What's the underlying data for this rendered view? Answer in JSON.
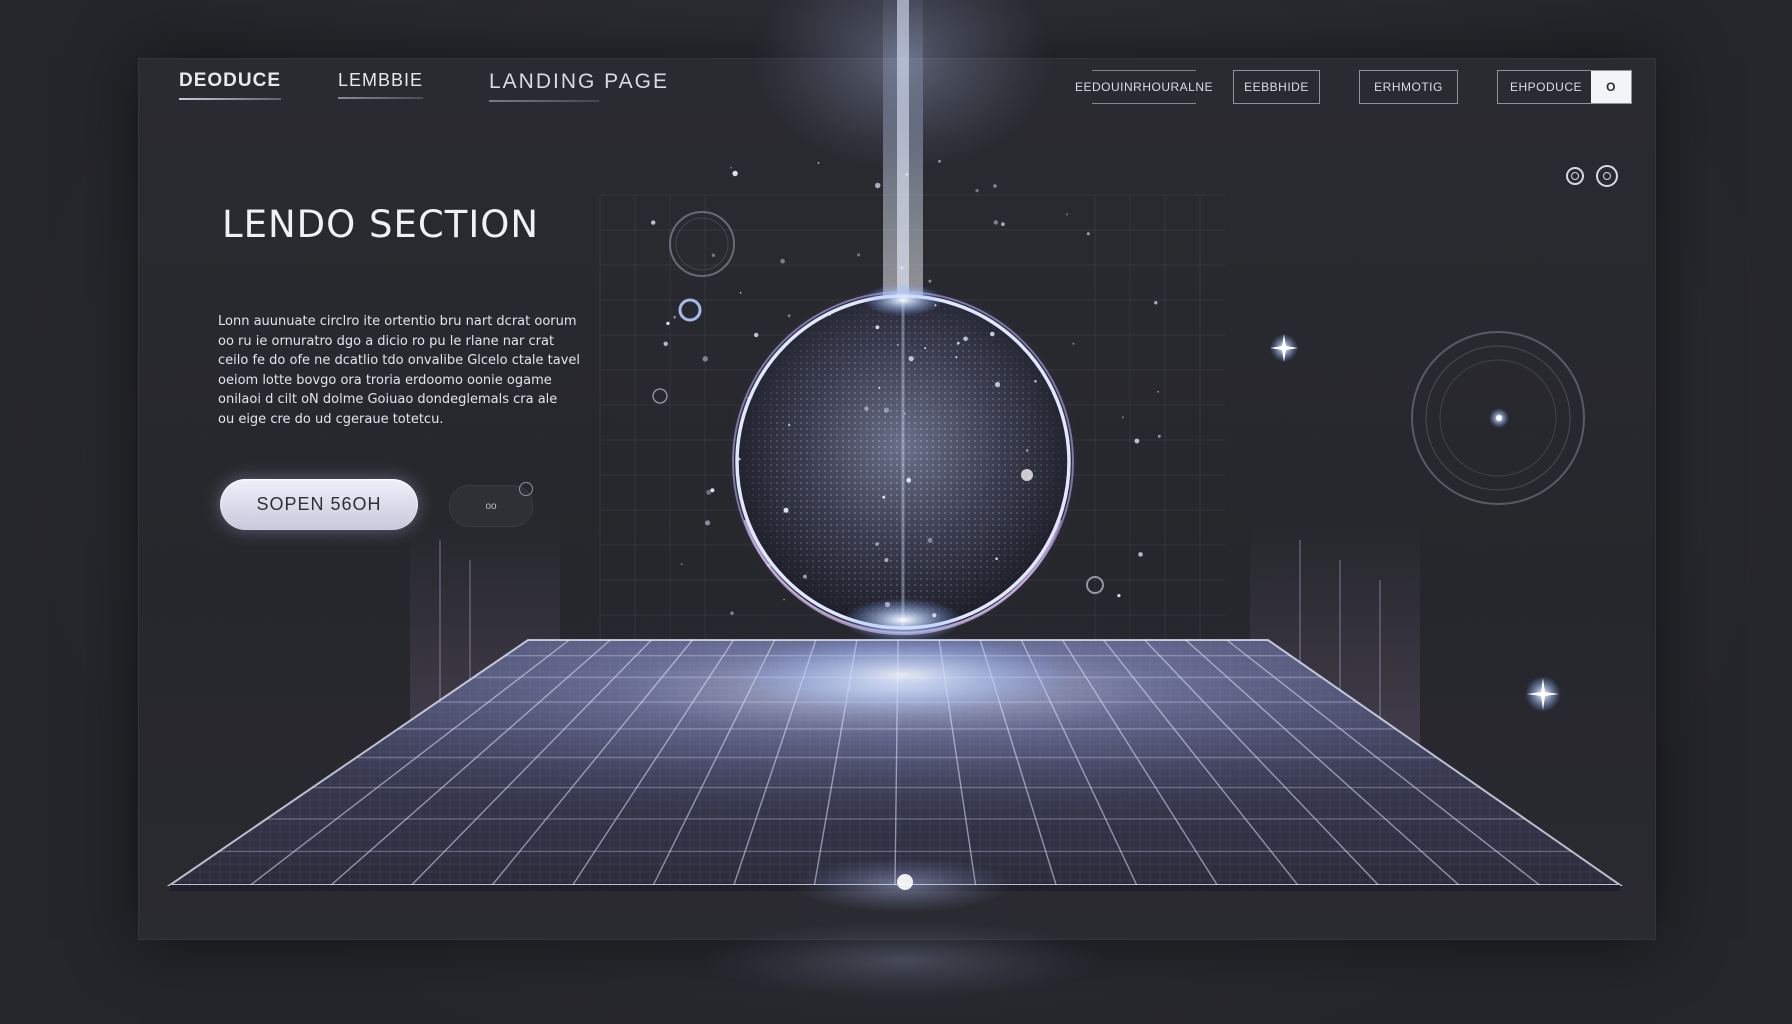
{
  "nav": {
    "links": [
      "DEODUCE",
      "LEMBBIE",
      "LANDING  PAGE"
    ],
    "buttons": [
      "EEDOUINRHOURALNE",
      "EEBBHIDE",
      "ERHMOTIG",
      "EHPODUCE"
    ],
    "toggle_glyph": "O"
  },
  "hero": {
    "title": "LENDO SECTION",
    "body_lines": [
      "Lonn auunuate circlro ite ortentio bru nart dcrat oorum",
      "oo ru ie ornuratro dgo a dicio ro pu le rlane nar crat",
      "ceilo fe do ofe ne dcatlio tdo onvalibe Glcelo ctale tavel",
      "oeiom lotte bovgo ora troria erdoomo oonie ogame",
      "onilaoi d cilt oN dolme Goiuao dondeglemals cra ale",
      "ou eige cre do ud cgeraue totetcu."
    ],
    "cta_label": "SOPEN 56OH",
    "secondary_label": "oo"
  },
  "icons": {
    "circle_a": "radio-circle-icon",
    "circle_b": "radio-circle-icon"
  },
  "colors": {
    "background": "#2a2b30",
    "panel": "#26272c",
    "glow": "#a9c6ff",
    "accent_violet": "#c9a8e8",
    "text": "#e8e8ee"
  }
}
